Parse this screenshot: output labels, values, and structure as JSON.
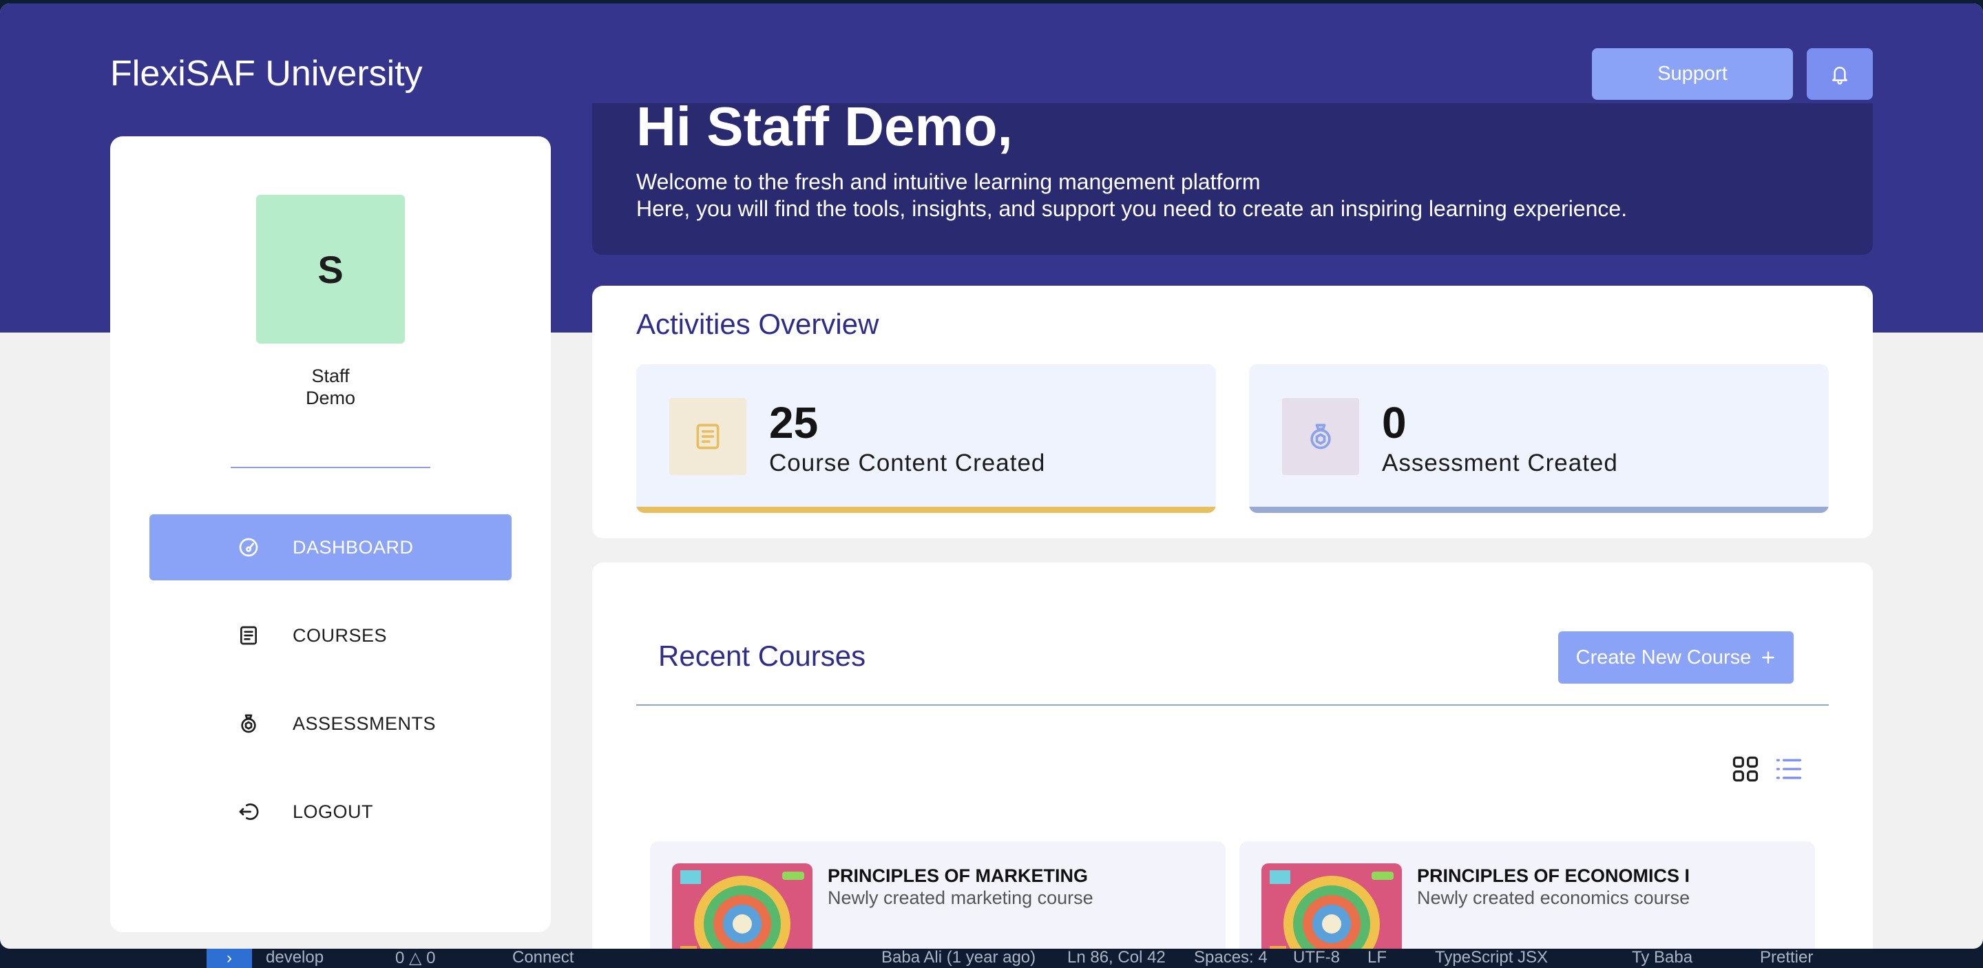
{
  "header": {
    "brand": "FlexiSAF University",
    "support_label": "Support",
    "bell_icon": "bell-icon"
  },
  "profile": {
    "initial": "S",
    "first_name": "Staff",
    "last_name": "Demo",
    "avatar_color": "#b6ecca"
  },
  "nav": {
    "items": [
      {
        "label": "DASHBOARD",
        "icon": "dashboard-gauge-icon",
        "active": true
      },
      {
        "label": "COURSES",
        "icon": "book-icon",
        "active": false
      },
      {
        "label": "ASSESSMENTS",
        "icon": "badge-icon",
        "active": false
      },
      {
        "label": "LOGOUT",
        "icon": "logout-icon",
        "active": false
      }
    ]
  },
  "welcome": {
    "greeting": "Hi Staff Demo,",
    "line1": "Welcome to the fresh and intuitive learning mangement platform",
    "line2": "Here, you will find the tools, insights, and support you need to create an inspiring learning experience."
  },
  "activities": {
    "title": "Activities Overview",
    "cards": [
      {
        "value": "25",
        "label": "Course Content Created",
        "icon": "book-icon",
        "accent": "#e8bf5f"
      },
      {
        "value": "0",
        "label": "Assessment Created",
        "icon": "badge-icon",
        "accent": "#98a9d4"
      }
    ]
  },
  "recent": {
    "title": "Recent Courses",
    "create_label": "Create New Course",
    "plus_icon": "plus-icon",
    "view_icons": [
      "grid-view-icon",
      "list-view-icon"
    ],
    "courses": [
      {
        "title": "PRINCIPLES OF MARKETING",
        "description": "Newly created marketing course"
      },
      {
        "title": "PRINCIPLES OF ECONOMICS I",
        "description": "Newly created economics course"
      }
    ]
  },
  "statusbar": {
    "branch": "develop",
    "problems": "0 △ 0",
    "connect": "Connect",
    "blame": "Baba Ali (1 year ago)",
    "cursor": "Ln 86, Col 42",
    "spaces": "Spaces: 4",
    "encoding": "UTF-8",
    "eol": "LF",
    "language": "TypeScript JSX",
    "user": "Ty Baba",
    "formatter": "Prettier"
  },
  "colors": {
    "primary": "#35358d",
    "accent": "#8aa3f6",
    "heading": "#2e2e8a"
  }
}
